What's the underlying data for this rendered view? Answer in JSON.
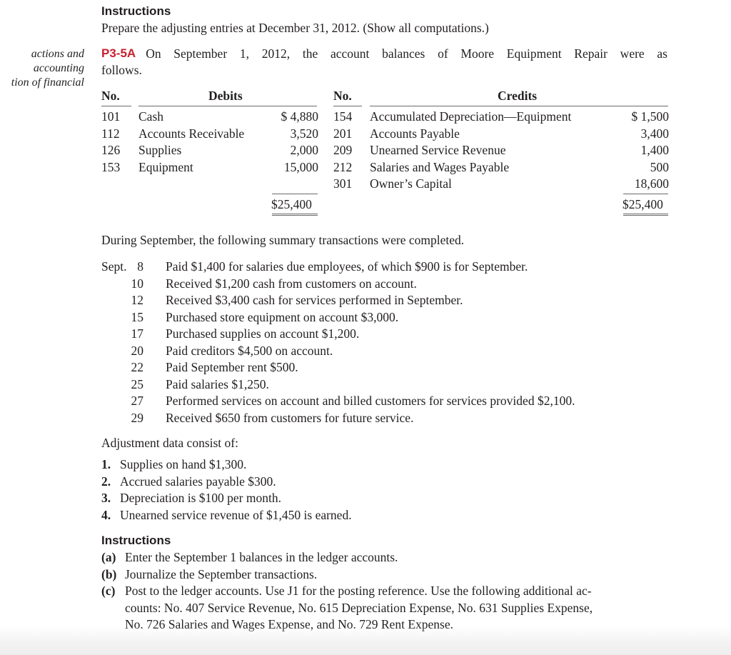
{
  "top_instructions": {
    "heading": "Instructions",
    "text": "Prepare the adjusting entries at December 31, 2012. (Show all computations.)"
  },
  "margin_note": [
    "actions and",
    "accounting",
    "tion of financial"
  ],
  "problem": {
    "id": "P3-5A",
    "intro_line1": "On September 1, 2012, the account balances of Moore Equipment Repair were as",
    "intro_line2": "follows."
  },
  "trial_balance": {
    "debits": {
      "no_header": "No.",
      "header": "Debits",
      "rows": [
        {
          "no": "101",
          "account": "Cash",
          "amount": "$ 4,880"
        },
        {
          "no": "112",
          "account": "Accounts Receivable",
          "amount": "3,520"
        },
        {
          "no": "126",
          "account": "Supplies",
          "amount": "2,000"
        },
        {
          "no": "153",
          "account": "Equipment",
          "amount": "15,000"
        }
      ],
      "total": "$25,400"
    },
    "credits": {
      "no_header": "No.",
      "header": "Credits",
      "rows": [
        {
          "no": "154",
          "account": "Accumulated Depreciation—Equipment",
          "amount": "$ 1,500"
        },
        {
          "no": "201",
          "account": "Accounts Payable",
          "amount": "3,400"
        },
        {
          "no": "209",
          "account": "Unearned Service Revenue",
          "amount": "1,400"
        },
        {
          "no": "212",
          "account": "Salaries and Wages Payable",
          "amount": "500"
        },
        {
          "no": "301",
          "account": "Owner’s Capital",
          "amount": "18,600"
        }
      ],
      "total": "$25,400"
    }
  },
  "transactions": {
    "intro": "During September, the following summary transactions were completed.",
    "month": "Sept.",
    "items": [
      {
        "day": "8",
        "text": "Paid $1,400 for salaries due employees, of which $900 is for September."
      },
      {
        "day": "10",
        "text": "Received $1,200 cash from customers on account."
      },
      {
        "day": "12",
        "text": "Received $3,400 cash for services performed in September."
      },
      {
        "day": "15",
        "text": "Purchased store equipment on account $3,000."
      },
      {
        "day": "17",
        "text": "Purchased supplies on account $1,200."
      },
      {
        "day": "20",
        "text": "Paid creditors $4,500 on account."
      },
      {
        "day": "22",
        "text": "Paid September rent $500."
      },
      {
        "day": "25",
        "text": "Paid salaries $1,250."
      },
      {
        "day": "27",
        "text": "Performed services on account and billed customers for services provided $2,100."
      },
      {
        "day": "29",
        "text": "Received $650 from customers for future service."
      }
    ]
  },
  "adjustments": {
    "intro": "Adjustment data consist of:",
    "items": [
      {
        "num": "1.",
        "text": "Supplies on hand $1,300."
      },
      {
        "num": "2.",
        "text": "Accrued salaries payable $300."
      },
      {
        "num": "3.",
        "text": "Depreciation is $100 per month."
      },
      {
        "num": "4.",
        "text": "Unearned service revenue of $1,450 is earned."
      }
    ]
  },
  "instructions": {
    "heading": "Instructions",
    "items": [
      {
        "label": "(a)",
        "lines": [
          "Enter the September 1 balances in the ledger accounts."
        ]
      },
      {
        "label": "(b)",
        "lines": [
          "Journalize the September transactions."
        ]
      },
      {
        "label": "(c)",
        "lines": [
          "Post to the ledger accounts. Use J1 for the posting reference. Use the following additional ac-",
          "counts: No. 407 Service Revenue, No. 615 Depreciation Expense, No. 631 Supplies Expense,",
          "No. 726 Salaries and Wages Expense, and No. 729 Rent Expense."
        ]
      }
    ]
  },
  "colors": {
    "problem_id": "#c8202f",
    "text": "#231f20"
  }
}
